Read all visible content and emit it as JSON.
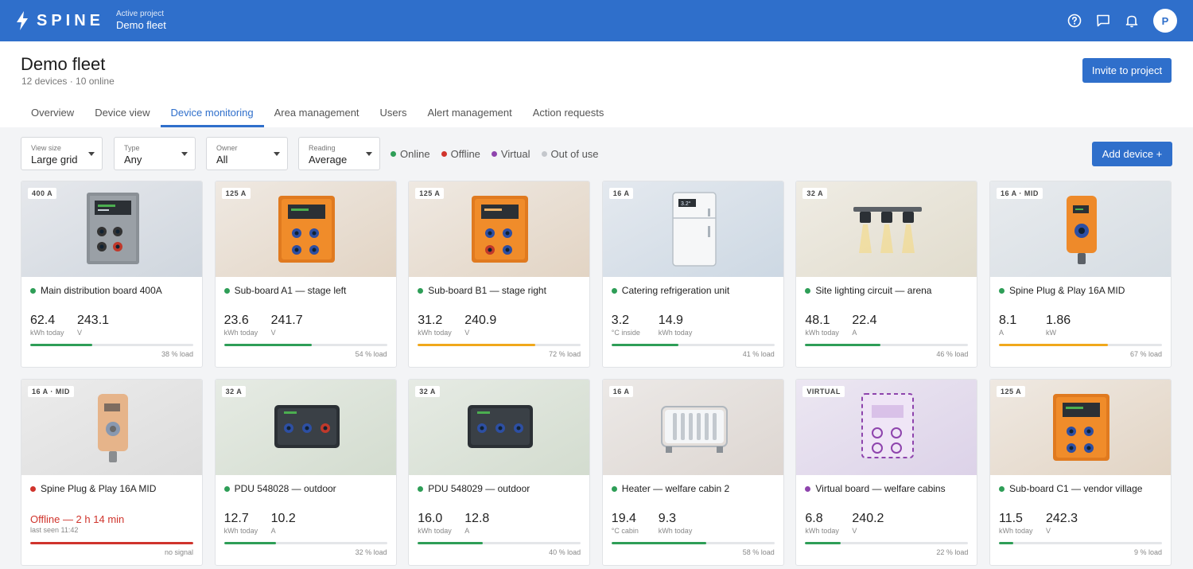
{
  "brand": {
    "name": "SPINE"
  },
  "project": {
    "label": "Active project",
    "name": "Demo fleet"
  },
  "topbar_icons": [
    "help-icon",
    "chat-icon",
    "bell-icon"
  ],
  "user": {
    "initial": "P"
  },
  "page": {
    "title": "Demo fleet",
    "subtitle": "12 devices · 10 online",
    "invite_label": "Invite to project"
  },
  "tabs": [
    {
      "label": "Overview",
      "active": false
    },
    {
      "label": "Device view",
      "active": false
    },
    {
      "label": "Device monitoring",
      "active": true
    },
    {
      "label": "Area management",
      "active": false
    },
    {
      "label": "Users",
      "active": false
    },
    {
      "label": "Alert management",
      "active": false
    },
    {
      "label": "Action requests",
      "active": false
    }
  ],
  "filters": [
    {
      "label": "View size",
      "value": "Large grid"
    },
    {
      "label": "Type",
      "value": "Any"
    },
    {
      "label": "Owner",
      "value": "All"
    },
    {
      "label": "Reading",
      "value": "Average"
    }
  ],
  "legend": [
    {
      "label": "Online",
      "color": "#2e9e57"
    },
    {
      "label": "Offline",
      "color": "#d0342c"
    },
    {
      "label": "Virtual",
      "color": "#8e44ad"
    },
    {
      "label": "Out of use",
      "color": "#c4c7cc"
    }
  ],
  "add_device_label": "Add device +",
  "colors": {
    "accent": "#2f6fcb",
    "online": "#2e9e57",
    "offline": "#d0342c",
    "virtual": "#8e44ad",
    "warn": "#f0a81c"
  },
  "devices": [
    {
      "badge": "400 A",
      "name": "Main distribution board 400A",
      "status": "online",
      "illustration": "grey-distribution-board",
      "m1": {
        "value": "62.4",
        "unit": "kWh today"
      },
      "m2": {
        "value": "243.1",
        "unit": "V"
      },
      "load_pct": 38,
      "load_text": "38 % load",
      "bar": "online"
    },
    {
      "badge": "125 A",
      "name": "Sub-board A1 — stage left",
      "status": "online",
      "illustration": "orange-sub-board",
      "m1": {
        "value": "23.6",
        "unit": "kWh today"
      },
      "m2": {
        "value": "241.7",
        "unit": "V"
      },
      "load_pct": 54,
      "load_text": "54 % load",
      "bar": "online"
    },
    {
      "badge": "125 A",
      "name": "Sub-board B1 — stage right",
      "status": "online",
      "illustration": "orange-sub-board-red-socket",
      "m1": {
        "value": "31.2",
        "unit": "kWh today"
      },
      "m2": {
        "value": "240.9",
        "unit": "V"
      },
      "load_pct": 72,
      "load_text": "72 % load",
      "bar": "warn"
    },
    {
      "badge": "16 A",
      "name": "Catering refrigeration unit",
      "status": "online",
      "illustration": "fridge",
      "display_text": "3.2°",
      "m1": {
        "value": "3.2",
        "unit": "°C inside"
      },
      "m2": {
        "value": "14.9",
        "unit": "kWh today"
      },
      "load_pct": 41,
      "load_text": "41 % load",
      "bar": "online"
    },
    {
      "badge": "32 A",
      "name": "Site lighting circuit — arena",
      "status": "online",
      "illustration": "light-rig",
      "m1": {
        "value": "48.1",
        "unit": "kWh today"
      },
      "m2": {
        "value": "22.4",
        "unit": "A"
      },
      "load_pct": 46,
      "load_text": "46 % load",
      "bar": "online"
    },
    {
      "badge": "16 A · MID",
      "name": "Spine Plug & Play 16A MID",
      "status": "online",
      "illustration": "orange-plug",
      "m1": {
        "value": "8.1",
        "unit": "A"
      },
      "m2": {
        "value": "1.86",
        "unit": "kW"
      },
      "load_pct": 67,
      "load_text": "67 % load",
      "bar": "warn"
    },
    {
      "badge": "16 A · MID",
      "name": "Spine Plug & Play 16A MID",
      "status": "offline",
      "illustration": "faded-plug",
      "offline": {
        "title": "Offline — 2 h 14 min",
        "sub": "last seen 11:42"
      },
      "load_pct": 100,
      "load_text": "no signal",
      "bar": "offline"
    },
    {
      "badge": "32 A",
      "name": "PDU 548028 — outdoor",
      "status": "online",
      "illustration": "pdu-red-socket",
      "m1": {
        "value": "12.7",
        "unit": "kWh today"
      },
      "m2": {
        "value": "10.2",
        "unit": "A"
      },
      "load_pct": 32,
      "load_text": "32 % load",
      "bar": "online"
    },
    {
      "badge": "32 A",
      "name": "PDU 548029 — outdoor",
      "status": "online",
      "illustration": "pdu",
      "m1": {
        "value": "16.0",
        "unit": "kWh today"
      },
      "m2": {
        "value": "12.8",
        "unit": "A"
      },
      "load_pct": 40,
      "load_text": "40 % load",
      "bar": "online"
    },
    {
      "badge": "16 A",
      "name": "Heater — welfare cabin 2",
      "status": "online",
      "illustration": "heater",
      "m1": {
        "value": "19.4",
        "unit": "°C cabin"
      },
      "m2": {
        "value": "9.3",
        "unit": "kWh today"
      },
      "load_pct": 58,
      "load_text": "58 % load",
      "bar": "online"
    },
    {
      "badge": "VIRTUAL",
      "name": "Virtual board — welfare cabins",
      "status": "virtual",
      "illustration": "virtual-board",
      "m1": {
        "value": "6.8",
        "unit": "kWh today"
      },
      "m2": {
        "value": "240.2",
        "unit": "V"
      },
      "load_pct": 22,
      "load_text": "22 % load",
      "bar": "online"
    },
    {
      "badge": "125 A",
      "name": "Sub-board C1 — vendor village",
      "status": "online",
      "illustration": "orange-sub-board",
      "m1": {
        "value": "11.5",
        "unit": "kWh today"
      },
      "m2": {
        "value": "242.3",
        "unit": "V"
      },
      "load_pct": 9,
      "load_text": "9 % load",
      "bar": "online"
    }
  ]
}
